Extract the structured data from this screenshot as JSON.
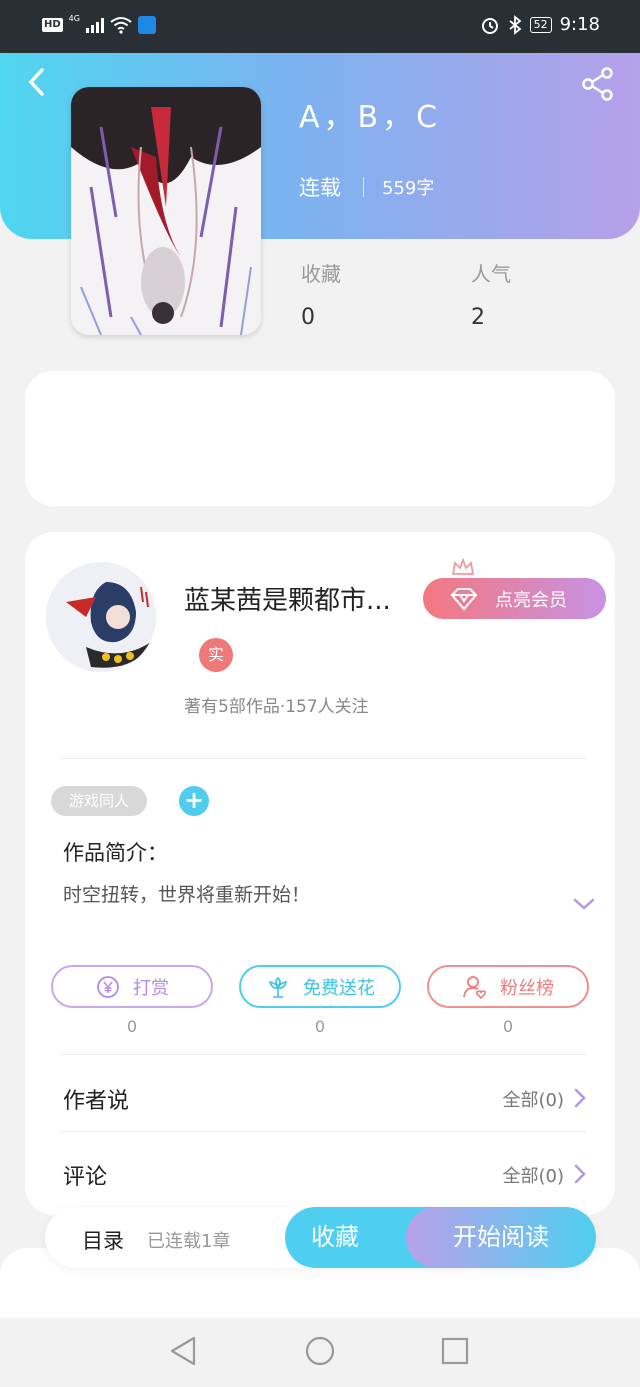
{
  "status_bar": {
    "left": "HD",
    "network": "4G",
    "battery": "52",
    "time": "9:18"
  },
  "book": {
    "title": "A，B，C",
    "status": "连载",
    "word_count": "559字",
    "stats": [
      {
        "label": "收藏",
        "value": "0"
      },
      {
        "label": "人气",
        "value": "2"
      }
    ]
  },
  "author": {
    "name": "蓝某茜是颗都市...",
    "badge": "实",
    "stats": "著有5部作品·157人关注",
    "vip_button": "点亮会员"
  },
  "tags": {
    "chip": "游戏同人",
    "add_symbol": "+"
  },
  "intro": {
    "title": "作品简介：",
    "text": "时空扭转，世界将重新开始！"
  },
  "actions": [
    {
      "label": "打赏",
      "count": "0",
      "color": "#b48be6"
    },
    {
      "label": "免费送花",
      "count": "0",
      "color": "#4fcdef"
    },
    {
      "label": "粉丝榜",
      "count": "0",
      "color": "#ef7c7c"
    }
  ],
  "sections": {
    "author_says": {
      "label": "作者说",
      "all": "全部(0)"
    },
    "comments": {
      "label": "评论",
      "all": "全部(0)"
    }
  },
  "bottom_bar": {
    "toc": "目录",
    "toc_sub": "已连载1章",
    "favorite": "收藏",
    "read": "开始阅读"
  },
  "colors": {
    "accent_cyan": "#4fcdef",
    "accent_purple": "#b6a0ea",
    "accent_red": "#ef7c7c"
  }
}
